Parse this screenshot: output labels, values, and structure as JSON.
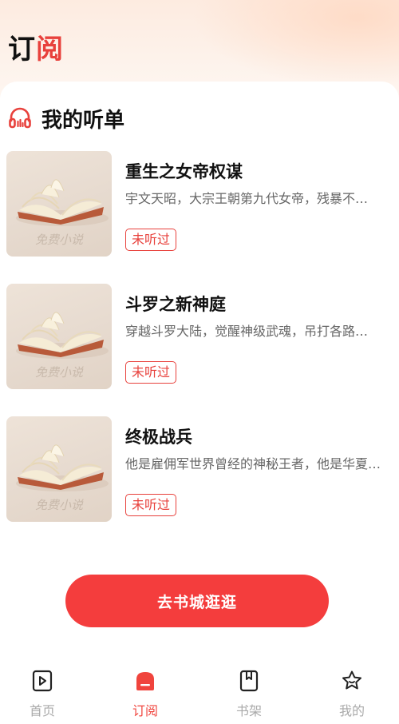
{
  "header": {
    "title_part1": "订",
    "title_part2": "阅"
  },
  "section": {
    "title": "我的听单",
    "icon": "headphones-icon"
  },
  "books": [
    {
      "title": "重生之女帝权谋",
      "description": "宇文天昭，大宗王朝第九代女帝，残暴不…",
      "status": "未听过",
      "cover_watermark": "免费小说"
    },
    {
      "title": "斗罗之新神庭",
      "description": "穿越斗罗大陆，觉醒神级武魂，吊打各路…",
      "status": "未听过",
      "cover_watermark": "免费小说"
    },
    {
      "title": "终极战兵",
      "description": "他是雇佣军世界曾经的神秘王者，他是华夏…",
      "status": "未听过",
      "cover_watermark": "免费小说"
    }
  ],
  "cta": {
    "label": "去书城逛逛"
  },
  "tabbar": {
    "active": "subscribe",
    "items": [
      {
        "id": "home",
        "label": "首页",
        "icon": "home-bookmark-icon"
      },
      {
        "id": "subscribe",
        "label": "订阅",
        "icon": "subscribe-icon"
      },
      {
        "id": "shelf",
        "label": "书架",
        "icon": "bookshelf-icon"
      },
      {
        "id": "mine",
        "label": "我的",
        "icon": "star-face-icon"
      }
    ]
  },
  "colors": {
    "accent": "#f43d3d",
    "status_border": "#e8413c",
    "inactive_tab": "#aaaaaa"
  }
}
